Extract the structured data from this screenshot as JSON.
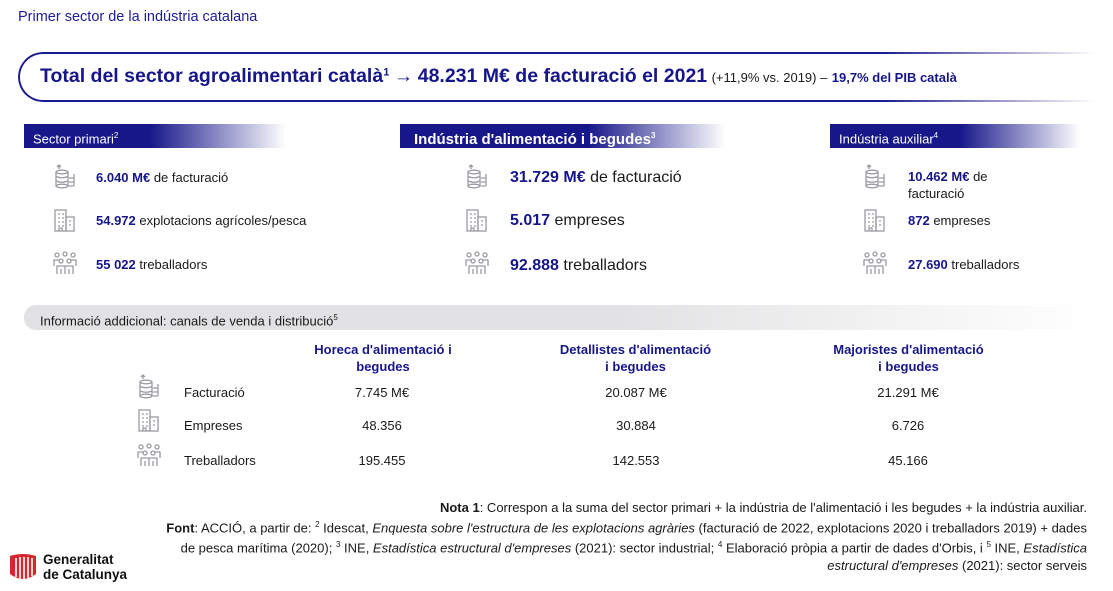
{
  "page_title": "Primer sector de la indústria catalana",
  "banner": {
    "main": "Total del sector agroalimentari català",
    "sup": "1",
    "arrow": "→",
    "value": "48.231 M€ de facturació el 2021",
    "change": "(+11,9% vs. 2019) –",
    "pib": "19,7% del PIB català"
  },
  "sections": {
    "primari": {
      "title": "Sector primari",
      "sup": "2",
      "facturacio_num": "6.040 M€",
      "facturacio_txt": "de facturació",
      "explotacions_num": "54.972",
      "explotacions_txt": "explotacions agrícoles/pesca",
      "treballadors_num": "55 022",
      "treballadors_txt": "treballadors"
    },
    "industria": {
      "title": "Indústria d'alimentació i begudes",
      "sup": "3",
      "facturacio_num": "31.729 M€",
      "facturacio_txt": "de facturació",
      "empreses_num": "5.017",
      "empreses_txt": "empreses",
      "treballadors_num": "92.888",
      "treballadors_txt": "treballadors"
    },
    "auxiliar": {
      "title": "Indústria auxiliar",
      "sup": "4",
      "facturacio_num": "10.462 M€",
      "facturacio_txt_1": "de",
      "facturacio_txt_2": "facturació",
      "empreses_num": "872",
      "empreses_txt": "empreses",
      "treballadors_num": "27.690",
      "treballadors_txt": "treballadors"
    }
  },
  "info_bar": {
    "label": "Informació addicional: canals de venda i distribució",
    "sup": "5"
  },
  "channels": {
    "columns": [
      {
        "line1": "Horeca d'alimentació i",
        "line2": "begudes"
      },
      {
        "line1": "Detallistes d'alimentació",
        "line2": "i begudes"
      },
      {
        "line1": "Majoristes d'alimentació",
        "line2": "i begudes"
      }
    ],
    "rows": [
      {
        "label": "Facturació",
        "values": [
          "7.745 M€",
          "20.087 M€",
          "21.291 M€"
        ]
      },
      {
        "label": "Empreses",
        "values": [
          "48.356",
          "30.884",
          "6.726"
        ]
      },
      {
        "label": "Treballadors",
        "values": [
          "195.455",
          "142.553",
          "45.166"
        ]
      }
    ]
  },
  "notes": {
    "nota_label": "Nota 1",
    "nota_text": ": Correspon a la suma del sector primari + la indústria de l'alimentació i les begudes + la indústria auxiliar.",
    "font_label": "Font",
    "font_a": ": ACCIÓ, a partir de: ",
    "s2": "2",
    "font_b": " Idescat, ",
    "font_b_em": "Enquesta sobre l'estructura de les explotacions agràries",
    "font_c": " (facturació de 2022, explotacions 2020 i treballadors 2019) + dades de pesca marítima (2020); ",
    "s3": "3",
    "font_d": " INE, ",
    "font_d_em": "Estadística estructural d'empreses",
    "font_e": " (2021): sector industrial; ",
    "s4": "4",
    "font_f": " Elaboració pròpia a partir de dades d'Orbis, i ",
    "s5": "5",
    "font_g": " INE, ",
    "font_g_em": "Estadística estructural d'empreses",
    "font_h": " (2021): sector serveis"
  },
  "logo": {
    "line1": "Generalitat",
    "line2": "de Catalunya",
    "color": "#d8262e"
  },
  "colors": {
    "primary": "#17178a",
    "info_bar": "#e2e2e4",
    "icon": "#9a9aa2"
  },
  "icons": {
    "facturacio": "coins-icon",
    "empreses": "building-icon",
    "treballadors": "people-icon"
  }
}
